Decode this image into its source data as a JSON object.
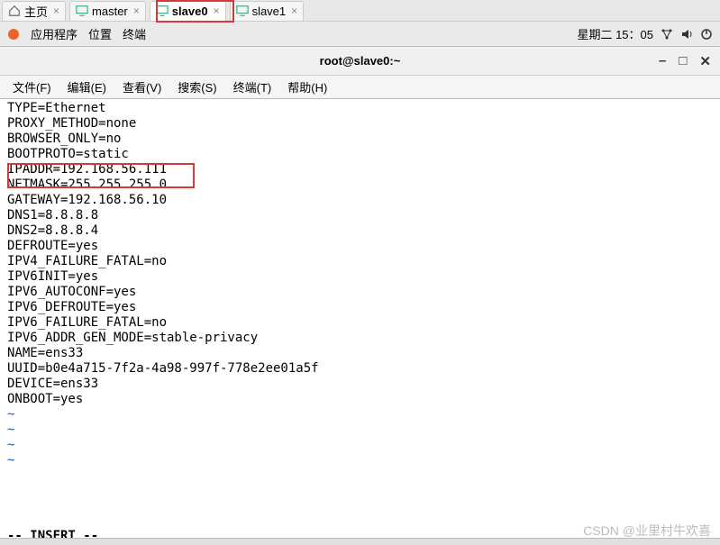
{
  "topTabs": {
    "items": [
      {
        "label": "主页",
        "iconColor": "#888"
      },
      {
        "label": "master",
        "iconColor": "#4a7"
      },
      {
        "label": "slave0",
        "iconColor": "#4a7",
        "active": true
      },
      {
        "label": "slave1",
        "iconColor": "#4a7"
      }
    ],
    "closeGlyph": "×"
  },
  "appBar": {
    "applications": "应用程序",
    "location": "位置",
    "terminal": "终端",
    "datetime": "星期二 15：05"
  },
  "window": {
    "title": "root@slave0:~"
  },
  "menuBar": {
    "file": "文件(F)",
    "edit": "编辑(E)",
    "view": "查看(V)",
    "search": "搜索(S)",
    "terminal": "终端(T)",
    "help": "帮助(H)"
  },
  "terminalLines": [
    "TYPE=Ethernet",
    "PROXY_METHOD=none",
    "BROWSER_ONLY=no",
    "BOOTPROTO=static",
    "IPADDR=192.168.56.111",
    "NETMASK=255.255.255.0",
    "GATEWAY=192.168.56.10",
    "DNS1=8.8.8.8",
    "DNS2=8.8.8.4",
    "DEFROUTE=yes",
    "IPV4_FAILURE_FATAL=no",
    "IPV6INIT=yes",
    "IPV6_AUTOCONF=yes",
    "IPV6_DEFROUTE=yes",
    "IPV6_FAILURE_FATAL=no",
    "IPV6_ADDR_GEN_MODE=stable-privacy",
    "NAME=ens33",
    "UUID=b0e4a715-7f2a-4a98-997f-778e2ee01a5f",
    "DEVICE=ens33",
    "ONBOOT=yes"
  ],
  "tildes": [
    "~",
    "~",
    "~",
    "~"
  ],
  "statusLine": "-- INSERT --",
  "watermark": "CSDN @业里村牛欢喜"
}
